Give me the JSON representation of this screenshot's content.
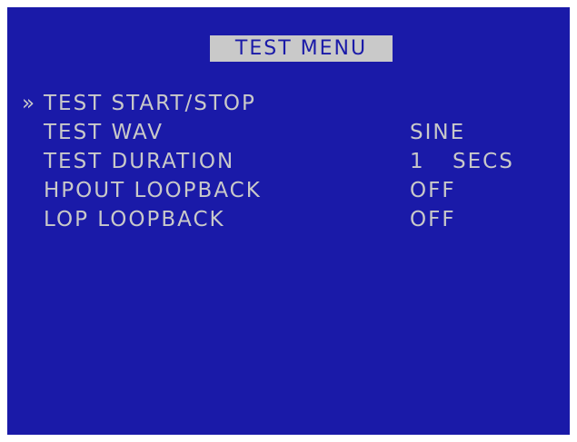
{
  "menu": {
    "title": "TEST MENU",
    "cursor": "»",
    "items": [
      {
        "label": "TEST START/STOP",
        "selected": true
      },
      {
        "label": "TEST WAV",
        "value": "SINE"
      },
      {
        "label": "TEST DURATION",
        "value_number": "1",
        "value_unit": "SECS"
      },
      {
        "label": "HPOUT LOOPBACK",
        "value": "OFF"
      },
      {
        "label": "LOP LOOPBACK",
        "value": "OFF"
      }
    ]
  },
  "colors": {
    "background": "#1a1aa8",
    "text": "#c9c9c9",
    "title_highlight": "#c9c9c9"
  }
}
